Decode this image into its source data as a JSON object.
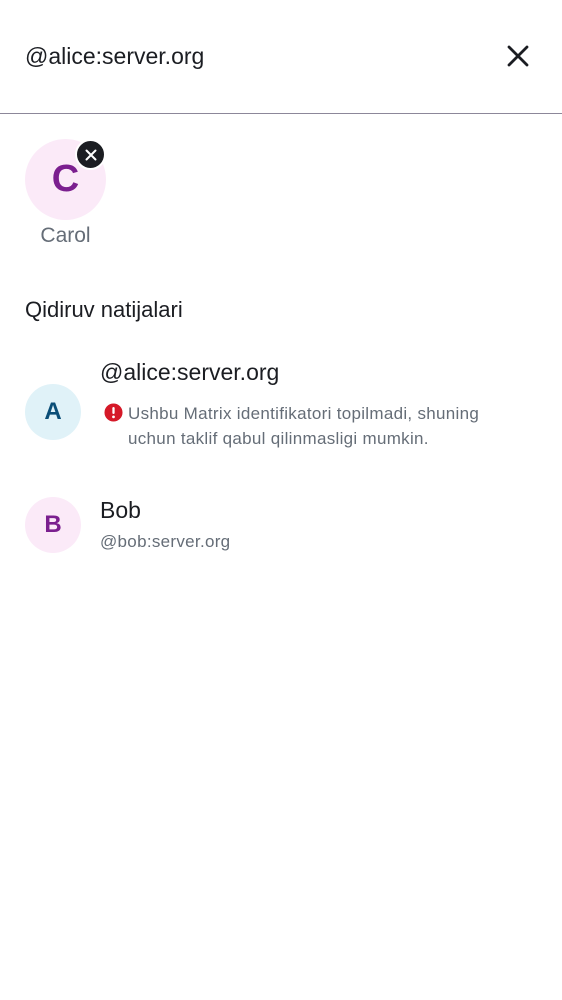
{
  "search": {
    "value": "@alice:server.org",
    "close_icon": "close-icon"
  },
  "selected": {
    "initial": "C",
    "name": "Carol",
    "avatar_bg": "#fbeaf8",
    "avatar_fg": "#7b1f8f",
    "remove_icon": "close-icon"
  },
  "results": {
    "header": "Qidiruv natijalari",
    "items": [
      {
        "initial": "A",
        "title": "@alice:server.org",
        "avatar_bg": "#e0f2f8",
        "avatar_fg": "#0b4e77",
        "warning_icon": "error-icon",
        "warning_color": "#d51928",
        "warning": "Ushbu Matrix identifikatori topilmadi, shuning uchun taklif qabul qilinmasligi mumkin."
      },
      {
        "initial": "B",
        "title": "Bob",
        "subtitle": "@bob:server.org",
        "avatar_bg": "#fbeaf8",
        "avatar_fg": "#7b1f8f"
      }
    ]
  }
}
